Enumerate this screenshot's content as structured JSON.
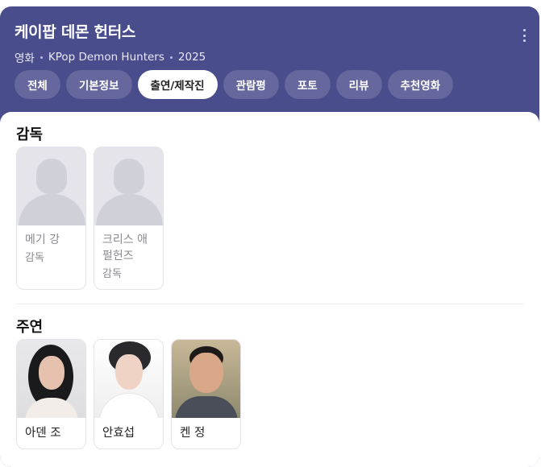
{
  "header": {
    "title": "케이팝 데몬 헌터스",
    "meta": [
      "영화",
      "KPop Demon Hunters",
      "2025"
    ]
  },
  "tabs": [
    {
      "label": "전체",
      "active": false
    },
    {
      "label": "기본정보",
      "active": false
    },
    {
      "label": "출연/제작진",
      "active": true
    },
    {
      "label": "관람평",
      "active": false
    },
    {
      "label": "포토",
      "active": false
    },
    {
      "label": "리뷰",
      "active": false
    },
    {
      "label": "추천영화",
      "active": false
    }
  ],
  "directors": {
    "title": "감독",
    "people": [
      {
        "name": "메기 강",
        "role": "감독",
        "photo": "placeholder-silhouette-icon"
      },
      {
        "name": "크리스 애펄헌즈",
        "role": "감독",
        "photo": "placeholder-silhouette-icon"
      }
    ]
  },
  "cast": {
    "title": "주연",
    "people": [
      {
        "name": "아덴 조"
      },
      {
        "name": "안효섭"
      },
      {
        "name": "켄 정"
      }
    ]
  },
  "colors": {
    "header_bg": "#4a4d8c",
    "tab_bg": "rgba(255,255,255,0.15)",
    "tab_active_bg": "#ffffff"
  }
}
